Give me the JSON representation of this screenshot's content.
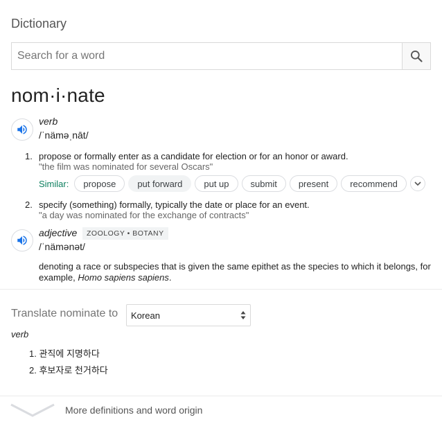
{
  "card": {
    "title": "Dictionary"
  },
  "search": {
    "placeholder": "Search for a word",
    "value": ""
  },
  "entry": {
    "headword": "nom·i·nate",
    "verb": {
      "pos": "verb",
      "phonetic": "/ˈnäməˌnāt/",
      "senses": [
        {
          "num": "1.",
          "definition": "propose or formally enter as a candidate for election or for an honor or award.",
          "example": "\"the film was nominated for several Oscars\""
        },
        {
          "num": "2.",
          "definition": "specify (something) formally, typically the date or place for an event.",
          "example": "\"a day was nominated for the exchange of contracts\""
        }
      ],
      "similar": {
        "label": "Similar:",
        "words": [
          "propose",
          "put forward",
          "put up",
          "submit",
          "present",
          "recommend"
        ]
      }
    },
    "adjective": {
      "pos": "adjective",
      "tag": "ZOOLOGY • BOTANY",
      "phonetic": "/ˈnämənət/",
      "definition_before": "denoting a race or subspecies that is given the same epithet as the species to which it belongs, for example, ",
      "definition_italic": "Homo sapiens sapiens",
      "definition_after": "."
    }
  },
  "translate": {
    "label": "Translate nominate to",
    "language": "Korean",
    "pos": "verb",
    "items": [
      "1. 관직에 지명하다",
      "2. 후보자로 천거하다"
    ]
  },
  "more": {
    "label": "More definitions and word origin"
  },
  "colors": {
    "similar_label": "#0e7f5f",
    "speaker_icon": "#1a73e8",
    "muted_text": "#757575"
  },
  "icons": {
    "search": "search-icon",
    "speaker": "speaker-icon",
    "expand": "chevron-down-icon",
    "more": "chevron-down-icon"
  }
}
